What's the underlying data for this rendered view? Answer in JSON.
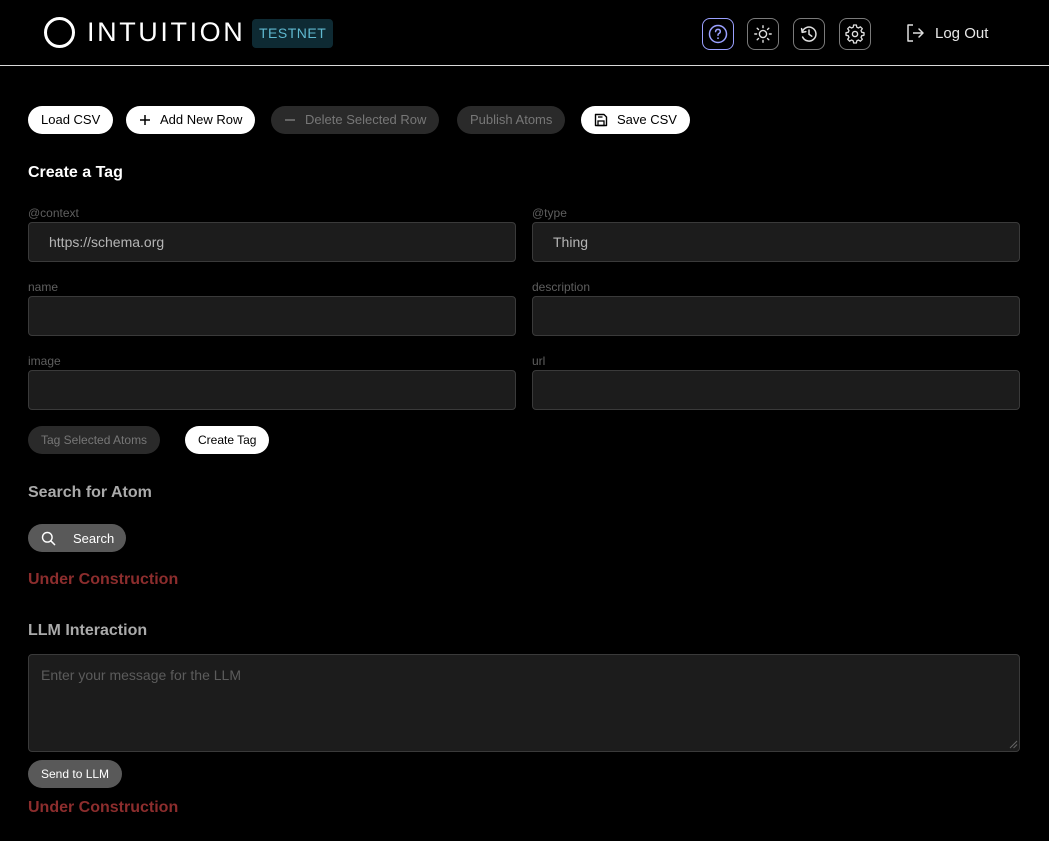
{
  "header": {
    "logo_text": "INTUITION",
    "network_badge": "TESTNET",
    "buttons": {
      "help_icon": "question-circle-icon",
      "theme_icon": "sun-icon",
      "history_icon": "history-icon",
      "settings_icon": "gear-icon"
    },
    "logout_label": "Log Out"
  },
  "toolbar": {
    "load_csv": "Load CSV",
    "add_row": "Add New Row",
    "delete_row": "Delete Selected Row",
    "publish_atoms": "Publish Atoms",
    "save_csv": "Save CSV"
  },
  "tag_form": {
    "title": "Create a Tag",
    "context_label": "@context",
    "context_value": "https://schema.org",
    "type_label": "@type",
    "type_value": "Thing",
    "name_label": "name",
    "name_value": "",
    "description_label": "description",
    "description_value": "",
    "image_label": "image",
    "image_value": "",
    "url_label": "url",
    "url_value": "",
    "tag_selected_label": "Tag Selected Atoms",
    "create_tag_label": "Create Tag"
  },
  "search": {
    "title": "Search for Atom",
    "button_label": "Search",
    "status": "Under Construction"
  },
  "llm": {
    "title": "LLM Interaction",
    "placeholder": "Enter your message for the LLM",
    "send_label": "Send to LLM",
    "status": "Under Construction"
  },
  "colors": {
    "background": "#000000",
    "badge_bg": "#0e2a33",
    "badge_text": "#5fb8cf",
    "warning": "#8c2d2d",
    "help_button_border": "#9aa0ff"
  }
}
